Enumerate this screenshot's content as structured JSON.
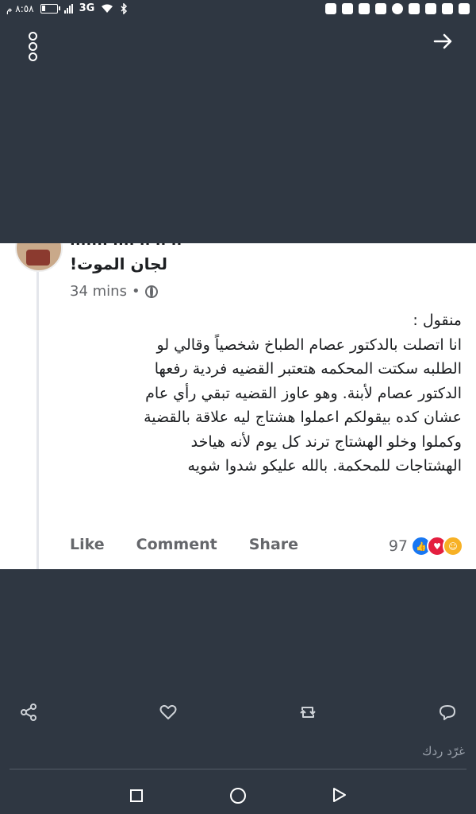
{
  "status_bar": {
    "time": "٨:٥٨ م",
    "battery_level": 0.25,
    "network": "3G",
    "icons": [
      "battery-icon",
      "signal-icon",
      "wifi-icon",
      "bluetooth-icon",
      "message-icon",
      "lock-icon",
      "youtube-icon",
      "image-icon",
      "whatsapp-icon",
      "facebook-icon",
      "app-icon",
      "messenger-icon",
      "notification-icon"
    ]
  },
  "toolbar": {
    "more_icon": "more-vertical-icon",
    "forward_icon": "forward-arrow-icon"
  },
  "post": {
    "author_cut": "....... .... .. .. ..",
    "title": "لجان الموت!",
    "time": "34 mins",
    "separator": "•",
    "privacy_icon": "globe-icon",
    "body_lines": [
      "منقول :",
      "انا اتصلت بالدكتور عصام الطباخ شخصياً وقالي لو",
      "الطلبه سكتت المحكمه هتعتبر القضيه فردية رفعها",
      "الدكتور عصام لأبنة. وهو عاوز القضيه تبقي رأي عام",
      "عشان كده بيقولكم اعملوا هشتاج ليه علاقة بالقضية",
      "وكملوا وخلو الهشتاج ترند كل يوم لأنه هياخد",
      "الهشتاجات للمحكمة. بالله عليكو شدوا شويه"
    ],
    "actions": {
      "like": "Like",
      "comment": "Comment",
      "share": "Share"
    },
    "reaction_count": "97",
    "reaction_types": [
      "like",
      "love",
      "care"
    ]
  },
  "bottom_bar": {
    "icons": [
      "share-icon",
      "heart-icon",
      "retweet-icon",
      "reply-icon"
    ],
    "reply_placeholder": "غرّد ردك"
  },
  "nav_bar": {
    "icons": [
      "recents-icon",
      "home-icon",
      "back-icon"
    ]
  },
  "colors": {
    "background": "#2f3742",
    "card": "#ffffff",
    "like_blue": "#1877f2",
    "love_red": "#e41e3f"
  }
}
